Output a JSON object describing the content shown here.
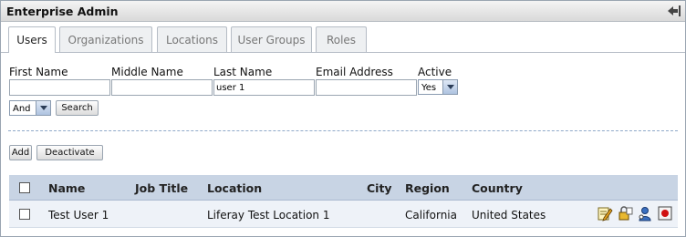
{
  "window": {
    "title": "Enterprise Admin"
  },
  "tabs": [
    {
      "label": "Users",
      "active": true
    },
    {
      "label": "Organizations",
      "active": false
    },
    {
      "label": "Locations",
      "active": false
    },
    {
      "label": "User Groups",
      "active": false
    },
    {
      "label": "Roles",
      "active": false
    }
  ],
  "search_form": {
    "first_name": {
      "label": "First Name",
      "value": ""
    },
    "middle_name": {
      "label": "Middle Name",
      "value": ""
    },
    "last_name": {
      "label": "Last Name",
      "value": "user 1"
    },
    "email_address": {
      "label": "Email Address",
      "value": ""
    },
    "active": {
      "label": "Active",
      "selected": "Yes"
    },
    "and_or": {
      "selected": "And"
    },
    "search_button": "Search"
  },
  "actions": {
    "add": "Add",
    "deactivate": "Deactivate"
  },
  "table": {
    "columns": [
      "Name",
      "Job Title",
      "Location",
      "City",
      "Region",
      "Country"
    ],
    "rows": [
      {
        "name": "Test User 1",
        "job_title": "",
        "location": "Liferay Test Location 1",
        "city": "",
        "region": "California",
        "country": "United States"
      }
    ],
    "row_action_icons": [
      "edit-icon",
      "permissions-icon",
      "impersonate-user-icon",
      "deactivate-icon"
    ]
  },
  "colors": {
    "header_bg": "#c8d4e4",
    "row_bg": "#eef2f8",
    "accent": "#8fa9c9"
  }
}
